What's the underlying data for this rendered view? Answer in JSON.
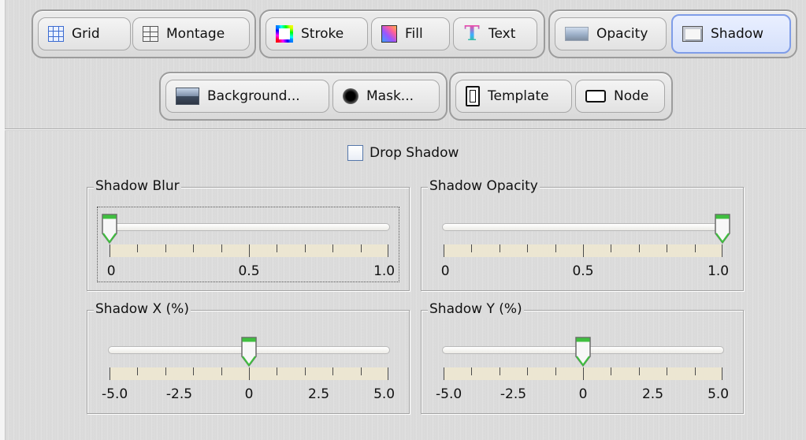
{
  "toolbar": {
    "groups": [
      [
        {
          "label": "Grid",
          "icon": "grid-icon"
        },
        {
          "label": "Montage",
          "icon": "montage-icon"
        }
      ],
      [
        {
          "label": "Stroke",
          "icon": "stroke-icon"
        },
        {
          "label": "Fill",
          "icon": "fill-icon"
        },
        {
          "label": "Text",
          "icon": "text-icon"
        }
      ],
      [
        {
          "label": "Opacity",
          "icon": "opacity-icon"
        },
        {
          "label": "Shadow",
          "icon": "shadow-icon",
          "selected": true
        }
      ],
      [
        {
          "label": "Background...",
          "icon": "background-icon"
        },
        {
          "label": "Mask...",
          "icon": "mask-icon"
        }
      ],
      [
        {
          "label": "Template",
          "icon": "template-icon"
        },
        {
          "label": "Node",
          "icon": "node-icon"
        }
      ]
    ],
    "text_icon_glyph": "T"
  },
  "drop_shadow": {
    "label": "Drop Shadow",
    "checked": false
  },
  "sliders": {
    "blur": {
      "title": "Shadow Blur",
      "min": 0,
      "max": 1.0,
      "value": 0,
      "labels": [
        "0",
        "0.5",
        "1.0"
      ],
      "focused": true
    },
    "opacity": {
      "title": "Shadow Opacity",
      "min": 0,
      "max": 1.0,
      "value": 1.0,
      "labels": [
        "0",
        "0.5",
        "1.0"
      ]
    },
    "x": {
      "title": "Shadow X (%)",
      "min": -5,
      "max": 5,
      "value": 0,
      "labels": [
        "-5.0",
        "-2.5",
        "0",
        "2.5",
        "5.0"
      ]
    },
    "y": {
      "title": "Shadow Y (%)",
      "min": -5,
      "max": 5,
      "value": 0,
      "labels": [
        "-5.0",
        "-2.5",
        "0",
        "2.5",
        "5.0"
      ]
    }
  },
  "colors": {
    "selected_tab_border": "#7f9de8",
    "thumb_green": "#3fbf3f"
  }
}
